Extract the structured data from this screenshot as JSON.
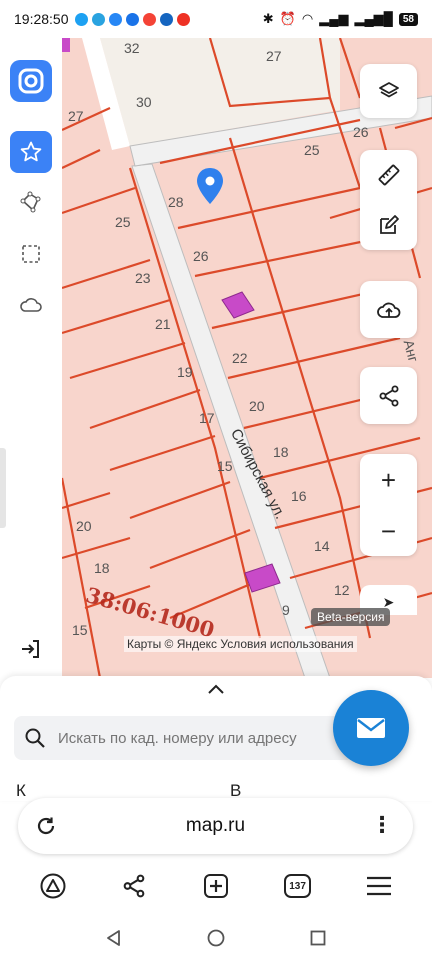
{
  "status_bar": {
    "time": "19:28:50",
    "battery": "58",
    "apps": [
      {
        "name": "messenger-app-icon",
        "color": "#1da1f2"
      },
      {
        "name": "telegram-icon",
        "color": "#2aa3e0"
      },
      {
        "name": "vk-icon",
        "color": "#2787f5"
      },
      {
        "name": "ok-icon",
        "color": "#1a73e8"
      },
      {
        "name": "yandex-browser-icon",
        "color": "#f44336"
      },
      {
        "name": "youtube-icon",
        "color": "#1565c0"
      },
      {
        "name": "yandex-icon",
        "color": "#ee3124"
      }
    ]
  },
  "map": {
    "street_name": "Сибирская ул.",
    "cadastral_number": "38:06:1000",
    "edge_label": "Анг",
    "parcel_numbers": [
      "32",
      "27",
      "30",
      "27",
      "26",
      "25",
      "28",
      "25",
      "26",
      "23",
      "21",
      "22",
      "19",
      "20",
      "17",
      "18",
      "15",
      "16",
      "20",
      "14",
      "18",
      "12",
      "9",
      "15"
    ],
    "beta_badge": "Beta-версия",
    "attribution": "Карты © Яндекс   Условия использования",
    "colors": {
      "parcel_fill": "#f8d5cc",
      "parcel_border": "#dc4a2a",
      "road": "#f1f1f1",
      "marker": "#2f80ed",
      "building": "#c84ac8"
    }
  },
  "left_toolbar": {
    "items": [
      {
        "name": "favorites-star-icon",
        "active": true
      },
      {
        "name": "polygon-tool-icon",
        "active": false
      },
      {
        "name": "selection-tool-icon",
        "active": false
      },
      {
        "name": "cloud-icon",
        "active": false
      }
    ],
    "exit_icon": "exit-icon"
  },
  "right_controls": {
    "layers": "layers-icon",
    "ruler": "ruler-icon",
    "edit": "edit-icon",
    "upload": "cloud-upload-icon",
    "share": "share-icon",
    "zoom_in": "+",
    "zoom_out": "−"
  },
  "sheet": {
    "search_placeholder": "Искать по кад. номеру или адресу",
    "cut_left": "К",
    "cut_right": "В"
  },
  "browser": {
    "url": "map.ru",
    "tab_count": "137"
  }
}
